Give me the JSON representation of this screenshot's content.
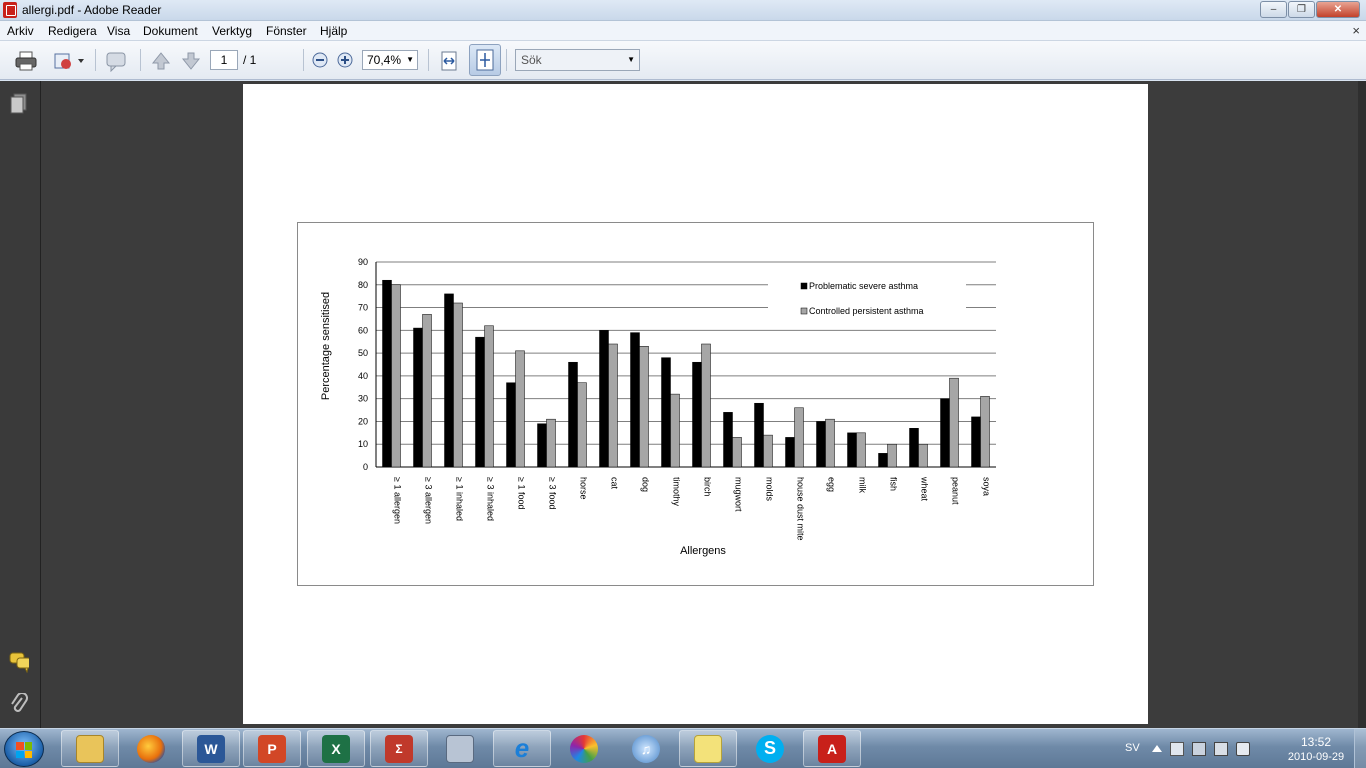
{
  "window": {
    "title": "allergi.pdf - Adobe Reader",
    "minimize": "–",
    "maximize": "❐",
    "close": "✕"
  },
  "menu": {
    "items": [
      "Arkiv",
      "Redigera",
      "Visa",
      "Dokument",
      "Verktyg",
      "Fönster",
      "Hjälp"
    ],
    "close": "×"
  },
  "toolbar": {
    "page_number": "1",
    "page_total": "/ 1",
    "zoom": "70,4%",
    "search_placeholder": "Sök"
  },
  "chart_data": {
    "type": "bar",
    "ylabel": "Percentage sensitised",
    "xlabel": "Allergens",
    "ylim": [
      0,
      90
    ],
    "yticks": [
      0,
      10,
      20,
      30,
      40,
      50,
      60,
      70,
      80,
      90
    ],
    "grid": true,
    "legend_position": "top-right",
    "categories": [
      "≥ 1 allergen",
      "≥ 3 allergen",
      "≥ 1 inhaled",
      "≥ 3 inhaled",
      "≥ 1 food",
      "≥ 3 food",
      "horse",
      "cat",
      "dog",
      "timothy",
      "birch",
      "mugwort",
      "molds",
      "house dust mite",
      "egg",
      "milk",
      "fish",
      "wheat",
      "peanut",
      "soya"
    ],
    "series": [
      {
        "name": "Problematic severe asthma",
        "color": "#000000",
        "values": [
          82,
          61,
          76,
          57,
          37,
          19,
          46,
          60,
          59,
          48,
          46,
          24,
          28,
          13,
          20,
          15,
          6,
          17,
          30,
          22
        ]
      },
      {
        "name": "Controlled persistent asthma",
        "color": "#a6a6a6",
        "values": [
          80,
          67,
          72,
          62,
          51,
          21,
          37,
          54,
          53,
          32,
          54,
          13,
          14,
          26,
          21,
          15,
          10,
          10,
          39,
          31
        ]
      }
    ]
  },
  "taskbar": {
    "apps": [
      "Windows Explorer",
      "Firefox",
      "Word",
      "PowerPoint",
      "Excel",
      "Math",
      "Calculator",
      "Internet Explorer",
      "Picasa",
      "iTunes",
      "Sticky Notes",
      "Skype",
      "Adobe Reader"
    ],
    "language": "SV",
    "time": "13:52",
    "date": "2010-09-29"
  }
}
